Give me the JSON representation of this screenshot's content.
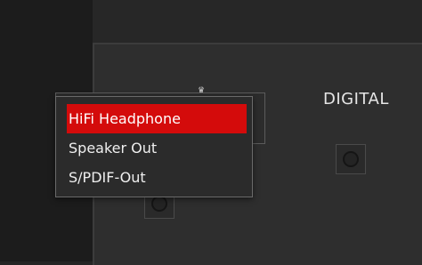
{
  "sections": {
    "digital_label": "DIGITAL"
  },
  "dropdown": {
    "options": [
      {
        "label": "HiFi Headphone",
        "selected": true
      },
      {
        "label": "Speaker Out",
        "selected": false
      },
      {
        "label": "S/PDIF-Out",
        "selected": false
      }
    ]
  },
  "colors": {
    "accent": "#d40b0b",
    "background": "#252525",
    "panel": "#2e2e2e",
    "text": "#efefef"
  },
  "icons": {
    "crown": "crown-icon",
    "jack": "audio-jack-icon"
  }
}
